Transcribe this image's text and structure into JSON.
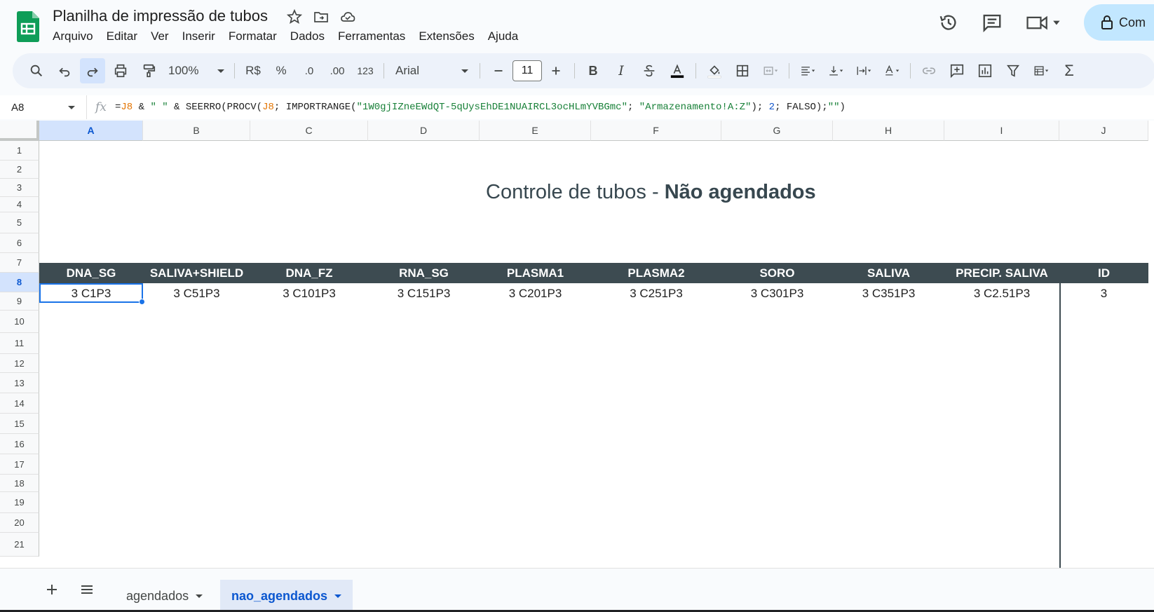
{
  "app": {
    "title": "Planilha de impressão de tubos",
    "menu": [
      "Arquivo",
      "Editar",
      "Ver",
      "Inserir",
      "Formatar",
      "Dados",
      "Ferramentas",
      "Extensões",
      "Ajuda"
    ],
    "share_label": "Com"
  },
  "toolbar": {
    "zoom": "100%",
    "currency": "R$",
    "percent": "%",
    "decrease_decimal": ".0",
    "increase_decimal": ".00",
    "number_format": "123",
    "font": "Arial",
    "font_size": "11",
    "bold": "B",
    "italic": "I",
    "sum": "Σ"
  },
  "formula_bar": {
    "cell_ref": "A8",
    "fx": "fx",
    "parts": [
      {
        "t": "=",
        "c": ""
      },
      {
        "t": "J8",
        "c": "f-ref"
      },
      {
        "t": " & ",
        "c": ""
      },
      {
        "t": "\" \"",
        "c": "f-str"
      },
      {
        "t": " & SEERRO(PROCV(",
        "c": ""
      },
      {
        "t": "J8",
        "c": "f-ref"
      },
      {
        "t": "; IMPORTRANGE(",
        "c": ""
      },
      {
        "t": "\"1W0gjIZneEWdQT-5qUysEhDE1NUAIRCL3ocHLmYVBGmc\"",
        "c": "f-str"
      },
      {
        "t": "; ",
        "c": ""
      },
      {
        "t": "\"Armazenamento!A:Z\"",
        "c": "f-str"
      },
      {
        "t": "); ",
        "c": ""
      },
      {
        "t": "2",
        "c": "f-num"
      },
      {
        "t": "; FALSO);",
        "c": ""
      },
      {
        "t": "\"\"",
        "c": "f-str"
      },
      {
        "t": ")",
        "c": ""
      }
    ]
  },
  "grid": {
    "columns": [
      "A",
      "B",
      "C",
      "D",
      "E",
      "F",
      "G",
      "H",
      "I",
      "J"
    ],
    "rows": [
      "1",
      "2",
      "3",
      "4",
      "5",
      "6",
      "7",
      "8",
      "9",
      "10",
      "11",
      "12",
      "13",
      "14",
      "15",
      "16",
      "17",
      "18",
      "19",
      "20",
      "21"
    ],
    "sheet_title_normal": "Controle de tubos - ",
    "sheet_title_bold": "Não agendados",
    "headers": [
      "DNA_SG",
      "SALIVA+SHIELD",
      "DNA_FZ",
      "RNA_SG",
      "PLASMA1",
      "PLASMA2",
      "SORO",
      "SALIVA",
      "PRECIP. SALIVA",
      "ID"
    ],
    "row8": [
      "3 C1P3",
      "3 C51P3",
      "3 C101P3",
      "3 C151P3",
      "3 C201P3",
      "3 C251P3",
      "3 C301P3",
      "3 C351P3",
      "3 C2.51P3",
      "3"
    ],
    "selected_cell": "A8"
  },
  "sheets": {
    "tabs": [
      "agendados",
      "nao_agendados"
    ],
    "active": "nao_agendados"
  },
  "colors": {
    "header_band": "#3d4b51",
    "accent": "#1a73e8",
    "share_bg": "#c2e7ff"
  }
}
